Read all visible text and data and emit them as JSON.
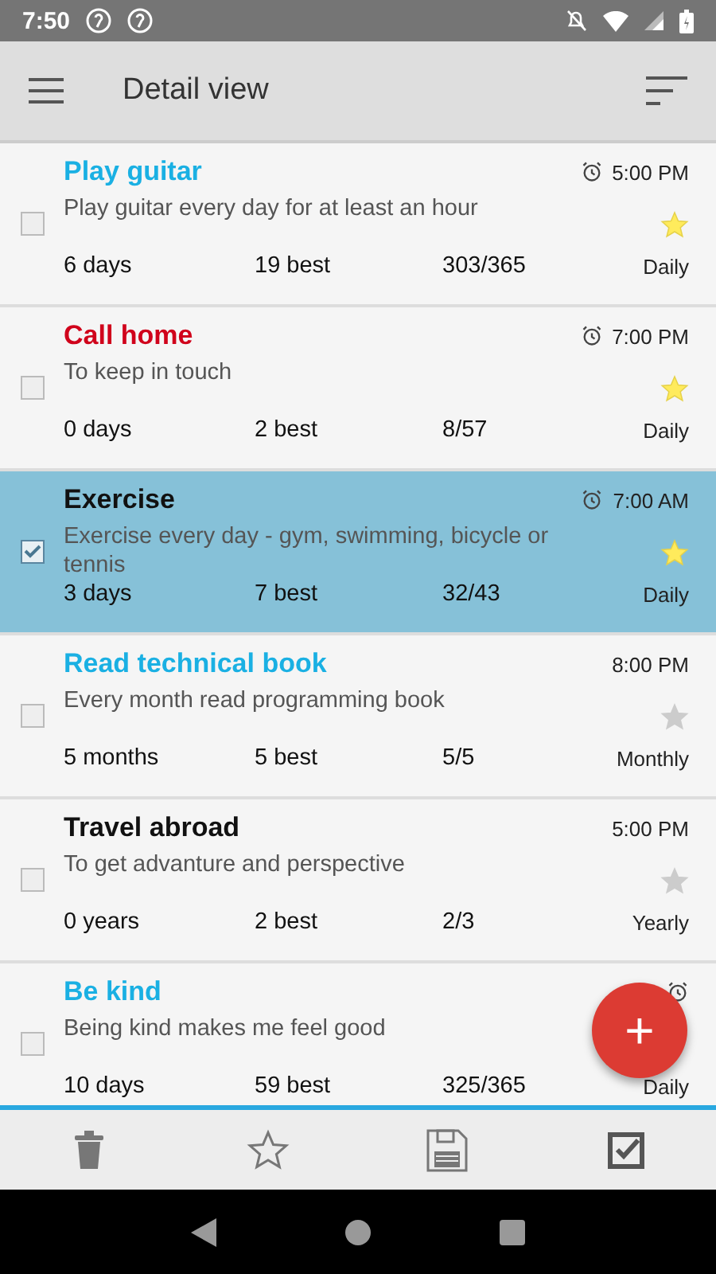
{
  "status_bar": {
    "time": "7:50"
  },
  "app_bar": {
    "title": "Detail view"
  },
  "habits": [
    {
      "title": "Play guitar",
      "color": "#1ab0e3",
      "description": "Play guitar every day for at least an hour",
      "time": "5:00 PM",
      "alarm": true,
      "starred": true,
      "checked": false,
      "selected": false,
      "streak": "6 days",
      "best": "19 best",
      "progress": "303/365",
      "frequency": "Daily"
    },
    {
      "title": "Call home",
      "color": "#d0021b",
      "description": "To keep in touch",
      "time": "7:00 PM",
      "alarm": true,
      "starred": true,
      "checked": false,
      "selected": false,
      "streak": "0 days",
      "best": "2 best",
      "progress": "8/57",
      "frequency": "Daily"
    },
    {
      "title": "Exercise",
      "color": "#111111",
      "description": "Exercise every day - gym, swimming, bicycle or tennis",
      "time": "7:00 AM",
      "alarm": true,
      "starred": true,
      "checked": true,
      "selected": true,
      "streak": "3 days",
      "best": "7 best",
      "progress": "32/43",
      "frequency": "Daily"
    },
    {
      "title": "Read technical book",
      "color": "#1ab0e3",
      "description": "Every month read programming book",
      "time": "8:00 PM",
      "alarm": false,
      "starred": false,
      "checked": false,
      "selected": false,
      "streak": "5 months",
      "best": "5 best",
      "progress": "5/5",
      "frequency": "Monthly"
    },
    {
      "title": "Travel abroad",
      "color": "#111111",
      "description": "To get advanture and perspective",
      "time": "5:00 PM",
      "alarm": false,
      "starred": false,
      "checked": false,
      "selected": false,
      "streak": "0 years",
      "best": "2 best",
      "progress": "2/3",
      "frequency": "Yearly"
    },
    {
      "title": "Be kind",
      "color": "#1ab0e3",
      "description": "Being kind makes me feel good",
      "alarm": true,
      "checked": false,
      "selected": false,
      "streak": "10 days",
      "best": "59 best",
      "progress": "325/365",
      "frequency": "Daily"
    }
  ],
  "fab": {
    "label": "+"
  }
}
